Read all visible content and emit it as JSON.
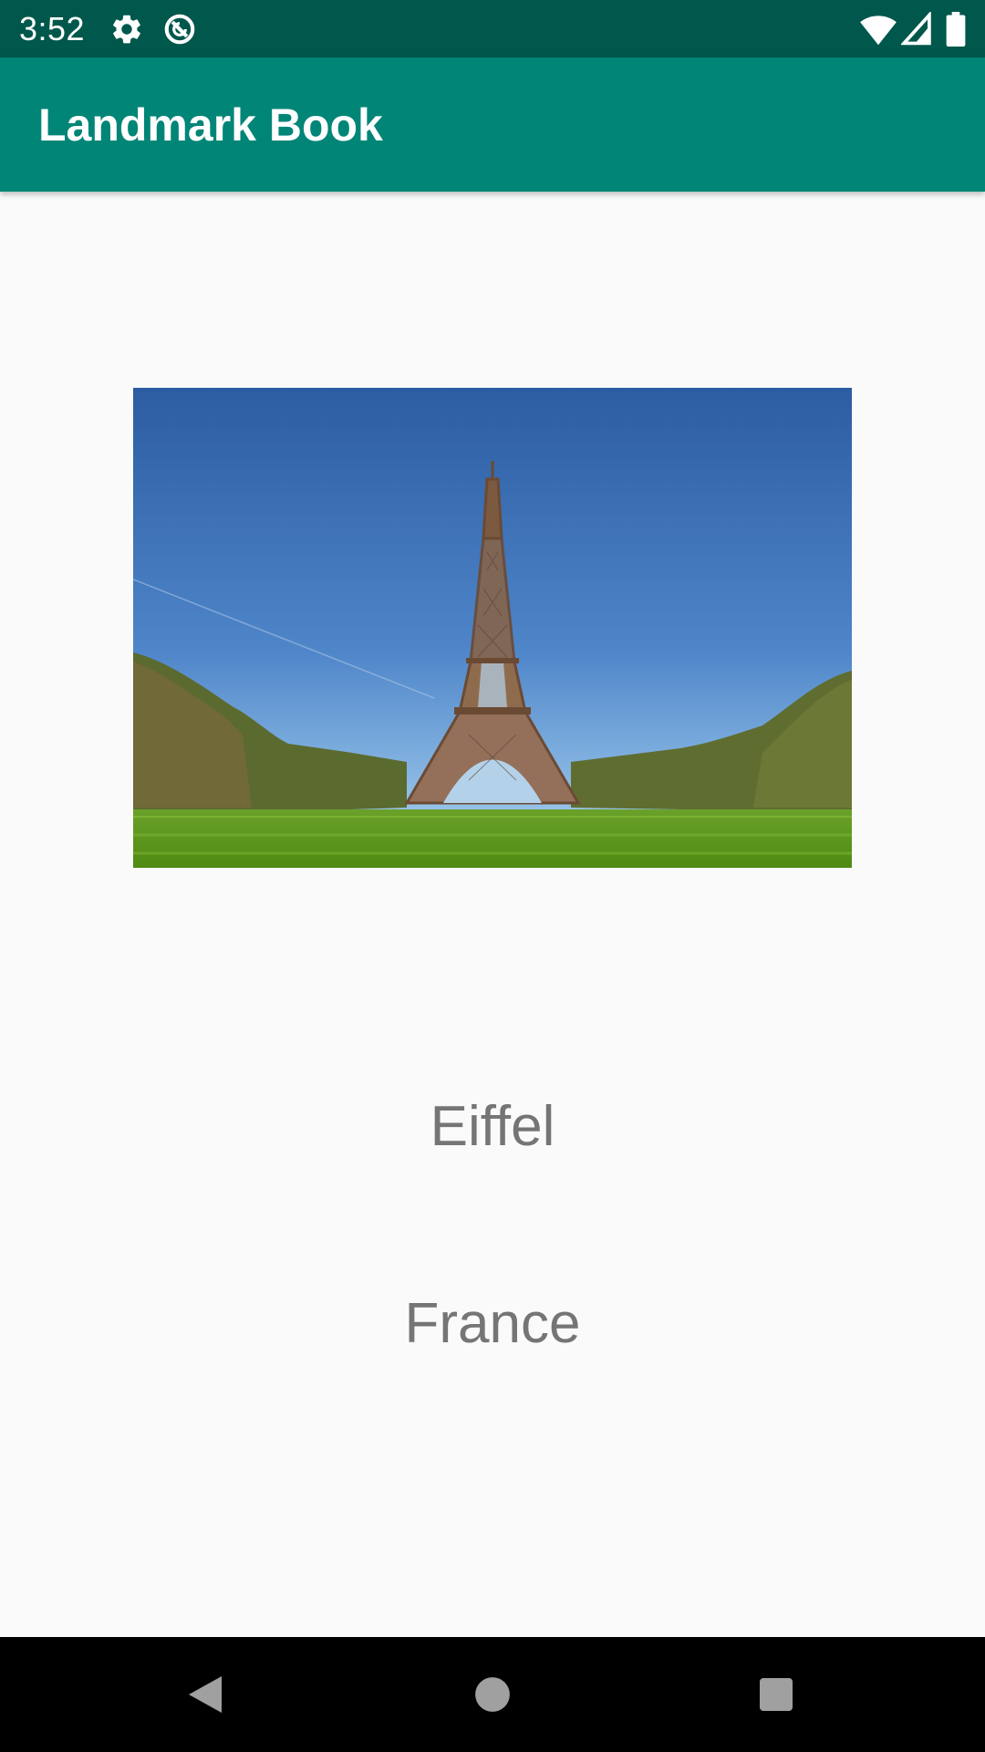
{
  "status_bar": {
    "time": "3:52",
    "icons": [
      "gear-icon",
      "sync-icon",
      "wifi-icon",
      "cell-signal-icon",
      "battery-icon"
    ],
    "background": "#00574b"
  },
  "app_bar": {
    "title": "Landmark Book",
    "background": "#008577"
  },
  "landmark": {
    "image_icon": "eiffel-tower-photo",
    "name": "Eiffel",
    "country": "France",
    "text_color": "#757575"
  },
  "nav_bar": {
    "buttons": [
      "back-icon",
      "home-icon",
      "recents-icon"
    ]
  }
}
